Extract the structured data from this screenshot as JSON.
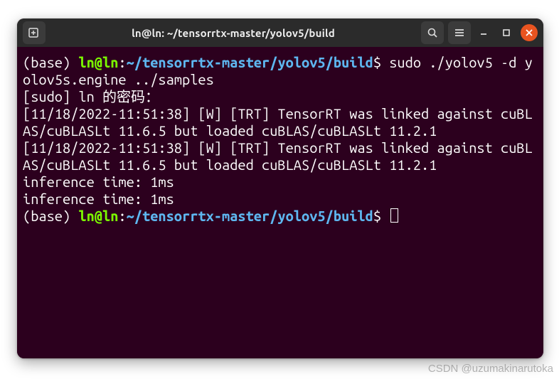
{
  "titlebar": {
    "title": "ln@ln: ~/tensorrtx-master/yolov5/build"
  },
  "prompt": {
    "env": "(base)",
    "userhost": "ln@ln",
    "sep": ":",
    "path": "~/tensorrtx-master/yolov5/build",
    "dollar": "$"
  },
  "cmd1": "sudo ./yolov5 -d yolov5s.engine ../samples",
  "output": [
    "[sudo] ln 的密码：",
    "[11/18/2022-11:51:38] [W] [TRT] TensorRT was linked against cuBLAS/cuBLASLt 11.6.5 but loaded cuBLAS/cuBLASLt 11.2.1",
    "[11/18/2022-11:51:38] [W] [TRT] TensorRT was linked against cuBLAS/cuBLASLt 11.6.5 but loaded cuBLAS/cuBLASLt 11.2.1",
    "inference time: 1ms",
    "inference time: 1ms"
  ],
  "watermark": "CSDN @uzumakinarutoka",
  "icons": {
    "newtab": "new-tab-icon",
    "search": "search-icon",
    "menu": "hamburger-menu-icon",
    "minimize": "minimize-icon",
    "maximize": "maximize-icon",
    "close": "close-icon"
  }
}
